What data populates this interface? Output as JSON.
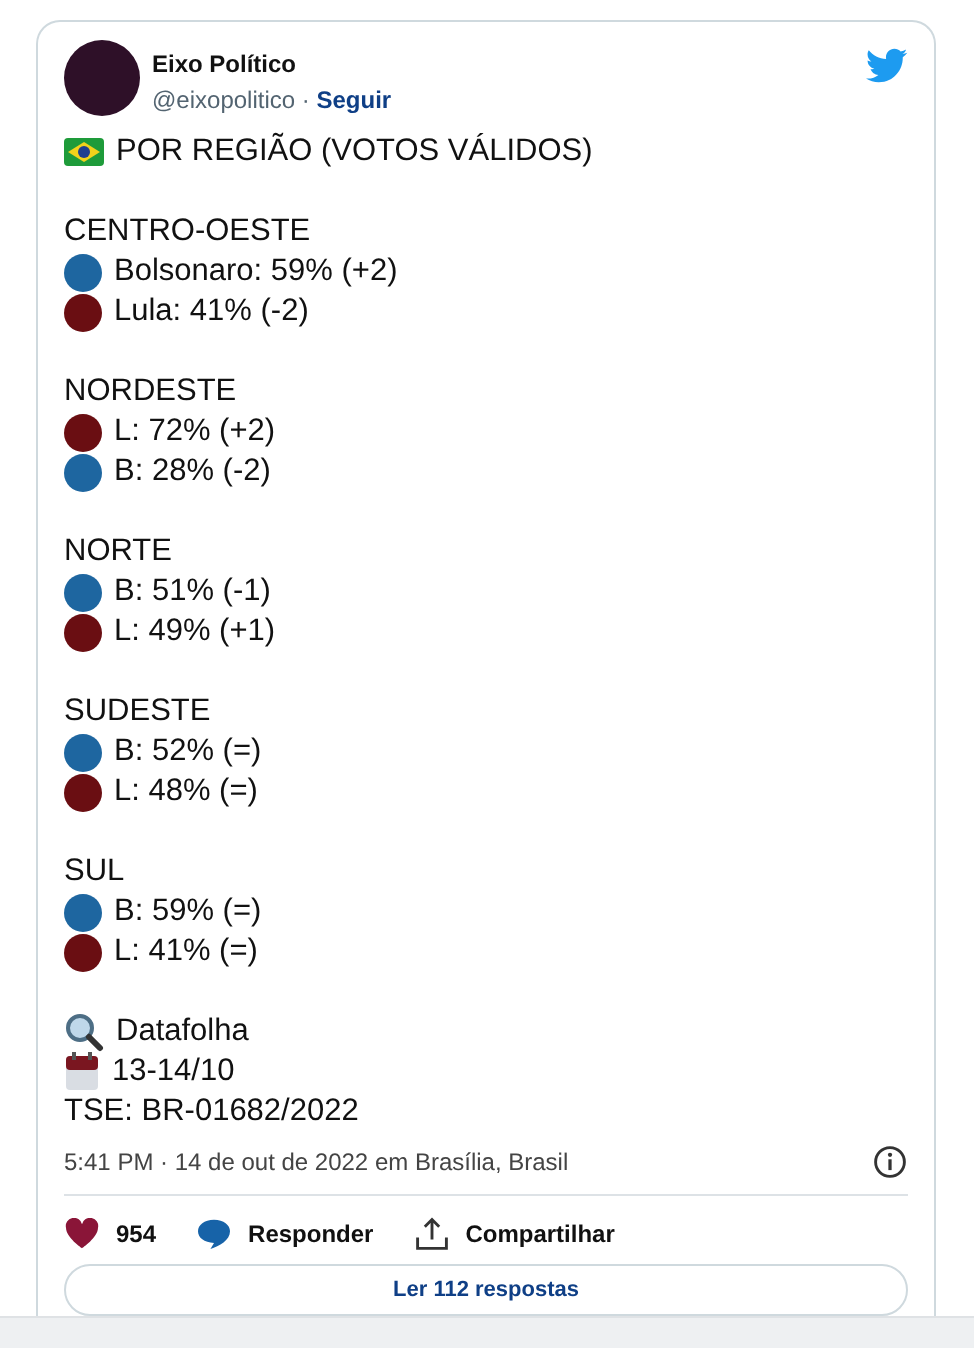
{
  "author": {
    "name": "Eixo Político",
    "handle": "@eixopolitico",
    "separator": "·",
    "follow": "Seguir"
  },
  "headline": {
    "text": "POR REGIÃO (VOTOS VÁLIDOS)"
  },
  "regions": [
    {
      "name": "CENTRO-OESTE",
      "entries": [
        {
          "text": "Bolsonaro: 59% (+2)",
          "color": "#1e66a0"
        },
        {
          "text": "Lula: 41% (-2)",
          "color": "#6a0e12"
        }
      ]
    },
    {
      "name": "NORDESTE",
      "entries": [
        {
          "text": "L: 72% (+2)",
          "color": "#6a0e12"
        },
        {
          "text": "B: 28% (-2)",
          "color": "#1e66a0"
        }
      ]
    },
    {
      "name": "NORTE",
      "entries": [
        {
          "text": "B: 51% (-1)",
          "color": "#1e66a0"
        },
        {
          "text": "L: 49% (+1)",
          "color": "#6a0e12"
        }
      ]
    },
    {
      "name": "SUDESTE",
      "entries": [
        {
          "text": "B: 52% (=)",
          "color": "#1e66a0"
        },
        {
          "text": "L: 48% (=)",
          "color": "#6a0e12"
        }
      ]
    },
    {
      "name": "SUL",
      "entries": [
        {
          "text": "B: 59% (=)",
          "color": "#1e66a0"
        },
        {
          "text": "L: 41% (=)",
          "color": "#6a0e12"
        }
      ]
    }
  ],
  "source": [
    {
      "kind": "search",
      "text": "Datafolha"
    },
    {
      "kind": "calendar",
      "text": "13-14/10"
    },
    {
      "kind": "plain",
      "text": "TSE: BR-01682/2022"
    }
  ],
  "timestamp": "5:41 PM · 14 de out de 2022 em Brasília, Brasil",
  "actions": [
    {
      "kind": "like",
      "label": "954"
    },
    {
      "kind": "reply",
      "label": "Responder"
    },
    {
      "kind": "share",
      "label": "Compartilhar"
    }
  ],
  "replies_button": "Ler 112 respostas"
}
